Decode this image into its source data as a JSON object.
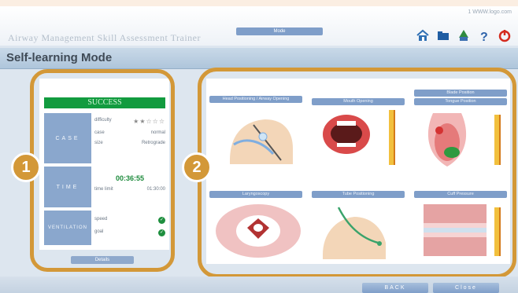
{
  "header": {
    "corner_link": "1 WWW.logo.com",
    "app_title": "Airway Management Skill Assessment Trainer",
    "center_tab": "Mode",
    "icons": [
      "home-icon",
      "folder-icon",
      "user-tree-icon",
      "help-icon",
      "power-icon"
    ]
  },
  "mode": {
    "title": "Self-learning Mode"
  },
  "results": {
    "success_label": "SUCCESS",
    "case": {
      "label": "CASE",
      "difficulty_key": "difficulty",
      "difficulty_stars_filled": 2,
      "difficulty_stars_total": 5,
      "stars": "★★☆☆☆",
      "mode_key": "case",
      "mode_value": "normal",
      "type_key": "size",
      "type_value": "Retrograde"
    },
    "time": {
      "label": "TIME",
      "total": "00:36:55",
      "sub_key": "time limit",
      "sub_value": "01:30:00"
    },
    "ventilation": {
      "label": "VENTILATION",
      "rows": [
        {
          "key": "speed",
          "status": "ok"
        },
        {
          "key": "goal",
          "status": "ok"
        }
      ]
    },
    "details_button": "Details"
  },
  "badges": [
    "1",
    "2"
  ],
  "thumbnails": [
    {
      "title": "Head Positioning / Airway Opening",
      "name": "head-tilt"
    },
    {
      "title": "Mouth Opening",
      "name": "mouth-opening"
    },
    {
      "title": "Tongue Position",
      "name": "tongue-position",
      "extra_title": "Blade Position"
    },
    {
      "title": "Laryngoscopy",
      "name": "laryngoscopy"
    },
    {
      "title": "Tube Positioning",
      "name": "tube-positioning"
    },
    {
      "title": "Cuff Pressure",
      "name": "cuff-pressure"
    }
  ],
  "footer": {
    "back": "BACK",
    "close": "Close"
  },
  "colors": {
    "accent_frame": "#d39838",
    "success": "#129b3f",
    "bar_blue": "#7f9ec9"
  }
}
